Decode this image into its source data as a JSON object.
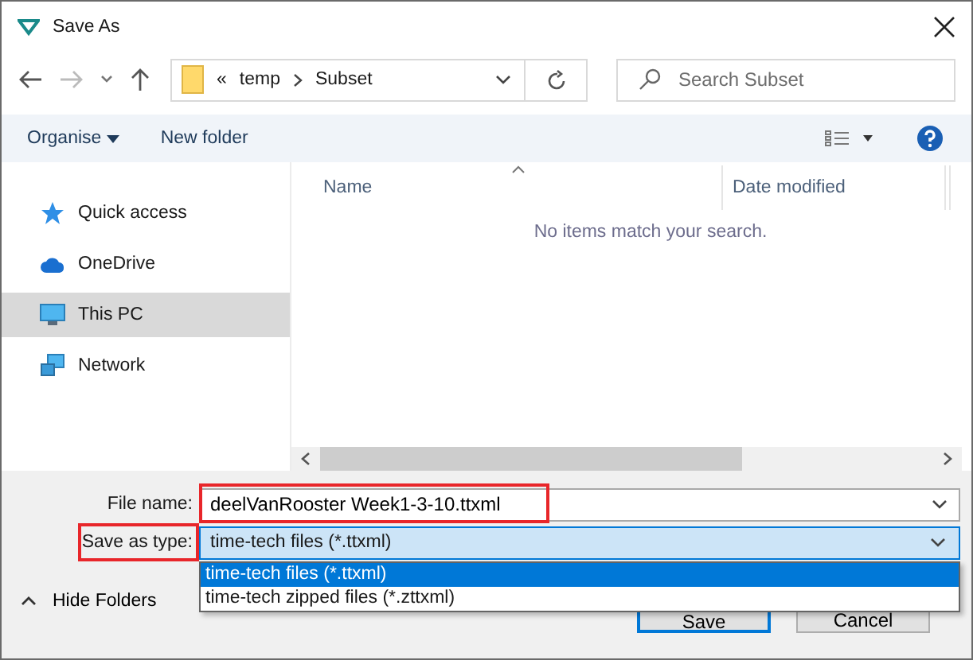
{
  "window": {
    "title": "Save As"
  },
  "address": {
    "overflow": "«",
    "crumbs": [
      "temp",
      "Subset"
    ]
  },
  "search": {
    "placeholder": "Search Subset"
  },
  "toolbar": {
    "organise": "Organise",
    "new_folder": "New folder"
  },
  "sidebar": {
    "items": [
      {
        "label": "Quick access",
        "kind": "star",
        "selected": false
      },
      {
        "label": "OneDrive",
        "kind": "cloud",
        "selected": false
      },
      {
        "label": "This PC",
        "kind": "pc",
        "selected": true
      },
      {
        "label": "Network",
        "kind": "network",
        "selected": false
      }
    ]
  },
  "table": {
    "columns": [
      "Name",
      "Date modified"
    ],
    "empty_message": "No items match your search."
  },
  "file_name": {
    "label": "File name:",
    "value": "deelVanRooster Week1-3-10.ttxml",
    "highlighted": true
  },
  "save_type": {
    "label": "Save as type:",
    "value": "time-tech files (*.ttxml)",
    "highlighted": true,
    "options": [
      {
        "label": "time-tech files (*.ttxml)",
        "selected": true
      },
      {
        "label": "time-tech zipped files (*.zttxml)",
        "selected": false
      }
    ]
  },
  "hide_folders": "Hide Folders",
  "buttons": [
    "Save",
    "Cancel"
  ]
}
